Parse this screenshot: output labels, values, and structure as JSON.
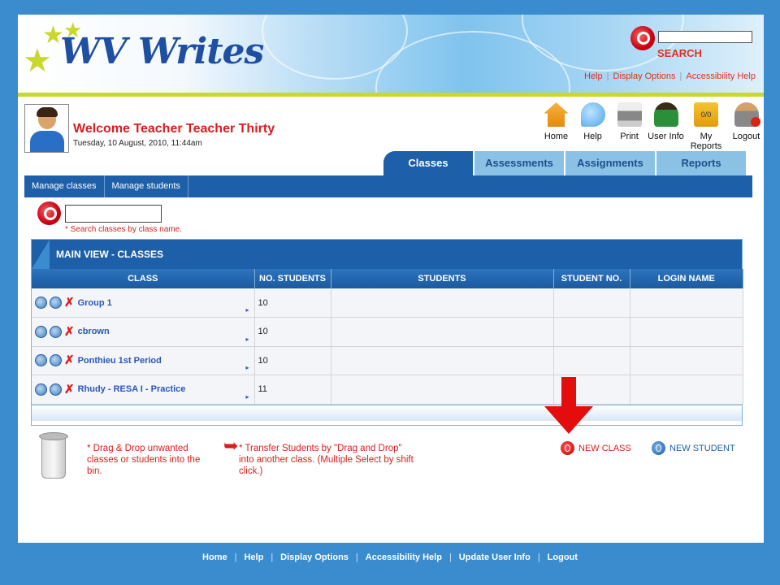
{
  "header": {
    "logo_text": "WV Writes",
    "search_label": "SEARCH",
    "links": [
      "Help",
      "Display Options",
      "Accessibility Help"
    ]
  },
  "user": {
    "welcome": "Welcome Teacher Teacher Thirty",
    "datetime": "Tuesday, 10 August, 2010,  11:44am"
  },
  "navicons": [
    {
      "label": "Home",
      "icon": "home-icon"
    },
    {
      "label": "Help",
      "icon": "help-bubble-icon"
    },
    {
      "label": "Print",
      "icon": "printer-icon"
    },
    {
      "label": "User Info",
      "icon": "user-icon"
    },
    {
      "label": "My Reports",
      "icon": "reports-folder-icon",
      "badge": "0/0"
    },
    {
      "label": "Logout",
      "icon": "logout-icon"
    }
  ],
  "tabs": [
    "Classes",
    "Assessments",
    "Assignments",
    "Reports"
  ],
  "subnav": [
    "Manage classes",
    "Manage students"
  ],
  "class_search": {
    "hint": "* Search classes by class name."
  },
  "main_view": {
    "title": "MAIN VIEW - CLASSES",
    "columns": [
      "CLASS",
      "NO. STUDENTS",
      "STUDENTS",
      "STUDENT NO.",
      "LOGIN NAME"
    ],
    "rows": [
      {
        "class": "Group 1",
        "students": "10"
      },
      {
        "class": "cbrown",
        "students": "10"
      },
      {
        "class": "Ponthieu 1st Period",
        "students": "10"
      },
      {
        "class": "Rhudy - RESA I - Practice",
        "students": "11"
      }
    ]
  },
  "notes": {
    "bin": "* Drag & Drop unwanted classes or students into the bin.",
    "transfer": "* Transfer Students by \"Drag and Drop\" into another class. (Multiple Select by shift click.)"
  },
  "actions": {
    "new_class": "NEW CLASS",
    "new_student": "NEW STUDENT"
  },
  "footer": [
    "Home",
    "Help",
    "Display Options",
    "Accessibility Help",
    "Update User Info",
    "Logout"
  ],
  "colors": {
    "brand_blue": "#1d5fa8",
    "accent_red": "#d81e1e",
    "lime": "#c8d82c",
    "background": "#3a8ccf"
  }
}
